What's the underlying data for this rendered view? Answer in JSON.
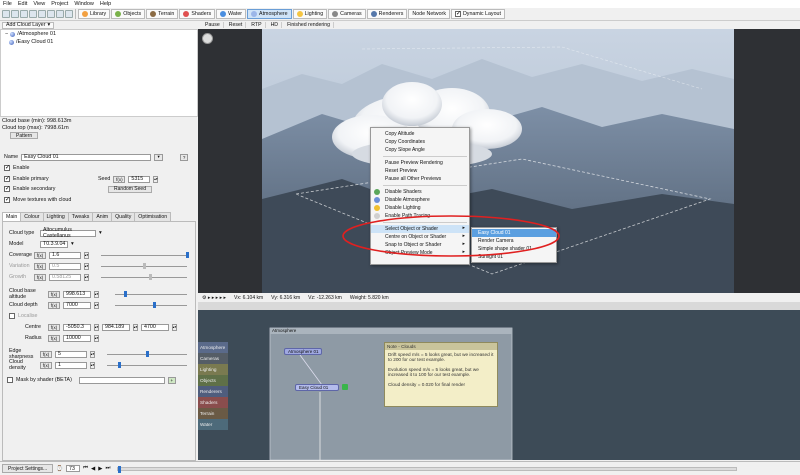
{
  "menubar": [
    "File",
    "Edit",
    "View",
    "Project",
    "Window",
    "Help"
  ],
  "toolbar": {
    "tabs": [
      {
        "label": "Library",
        "color": "#f2a041"
      },
      {
        "label": "Objects",
        "color": "#7ab24a"
      },
      {
        "label": "Terrain",
        "color": "#8b6b43"
      },
      {
        "label": "Shaders",
        "color": "#e05050"
      },
      {
        "label": "Water",
        "color": "#4a8ee0"
      },
      {
        "label": "Atmosphere",
        "color": "#9bb6e8",
        "active": true
      },
      {
        "label": "Lighting",
        "color": "#f5c542"
      },
      {
        "label": "Cameras",
        "color": "#888888"
      },
      {
        "label": "Renderers",
        "color": "#5577aa"
      },
      {
        "label": "Node Network",
        "color": "#666666"
      }
    ],
    "dynamic_layout": "Dynamic Layout"
  },
  "left_toolbar": {
    "add_cloud_layer": "Add Cloud Layer"
  },
  "viewport_toolbar": {
    "pause": "Pause",
    "reset": "Reset",
    "rtp": "RTP",
    "hd": "HD",
    "status": "Finished rendering"
  },
  "tree": {
    "items": [
      "/Atmosphere 01",
      "/Easy Cloud 01"
    ]
  },
  "cloud_info": {
    "base": "Cloud base (min): 998.613m",
    "top": "Cloud top (max): 7998.61m",
    "pattern": "Pattern"
  },
  "props": {
    "name_label": "Name",
    "name_value": "Easy Cloud 01",
    "enable": "Enable",
    "enable_primary": "Enable primary",
    "enable_secondary": "Enable secondary",
    "move_textures": "Move textures with cloud",
    "seed_label": "Seed",
    "seed_value": "5315",
    "random_seed": "Random Seed",
    "tabs": [
      "Main",
      "Colour",
      "Lighting",
      "Tweaks",
      "Anim",
      "Quality",
      "Optimisation"
    ],
    "cloud_type_label": "Cloud type",
    "cloud_type_value": "Altocumulus Castellanus",
    "model_label": "Model",
    "model_value": "T0.3.9.04",
    "coverage_label": "Coverage",
    "coverage_value": "1.6",
    "variation_label": "Variation",
    "variation_value": "0.5",
    "growth_label": "Growth",
    "growth_value": "0.58125",
    "base_alt_label": "Cloud base altitude",
    "base_alt_value": "998.613",
    "depth_label": "Cloud depth",
    "depth_value": "7000",
    "localise": "Localise",
    "centre_label": "Centre",
    "centre_x": "-5050.3",
    "centre_y": "984.189",
    "centre_z": "4700",
    "radius_label": "Radius",
    "radius_value": "10000",
    "edge_label": "Edge sharpness",
    "edge_value": "5",
    "density_label": "Cloud density",
    "density_value": "1",
    "mask_label": "Mask by shader (BETA)",
    "levels": {
      "coverage": 1.0,
      "variation": 0.5,
      "growth": 0.58,
      "base_alt": 0.15,
      "depth": 0.55,
      "edge": 0.5,
      "density": 0.15
    }
  },
  "context_menu": {
    "items": [
      "Copy Altitude",
      "Copy Coordinates",
      "Copy Slope Angle",
      "Pause Preview Rendering",
      "Reset Preview",
      "Pause all Other Previews",
      "Disable Shaders",
      "Disable Atmosphere",
      "Disable Lighting",
      "Enable Path Tracing",
      "Select Object or Shader",
      "Centre on Object or Shader",
      "Snap to Object or Shader",
      "Object Preview Mode"
    ],
    "submenu": [
      "Easy Cloud 01",
      "Render Camera",
      "Simple shape shader 01",
      "Sunlight 01"
    ]
  },
  "viewport_status": {
    "vx": "Vx: 6.104 km",
    "vy": "Vy: 6.316 km",
    "vz": "Vz: -12.263 km",
    "weight": "Weight: 5.820 km"
  },
  "node_network": {
    "group_label": "Atmosphere",
    "side_tabs": [
      "Atmosphere",
      "Cameras",
      "Lighting",
      "Objects",
      "Renderers",
      "Shaders",
      "Terrain",
      "Water"
    ],
    "side_colors": [
      "#5a6a8a",
      "#555d66",
      "#7a7a50",
      "#5f7048",
      "#4f5d7d",
      "#8a4d4d",
      "#6a5a45",
      "#4d6a7a"
    ],
    "nodes": [
      "Atmosphere 01",
      "Easy Cloud 01"
    ],
    "note_title": "Note - Clouds",
    "note_lines": [
      "Drift speed m/s = 5 looks great, but we increased it to 200 for our test example.",
      "Evolution speed m/s = 5 looks great, but we increased it to 100 for our test example.",
      "Cloud density = 0.020 for final render"
    ]
  },
  "bottombar": {
    "project_settings": "Project Settings...",
    "frame": "73"
  }
}
